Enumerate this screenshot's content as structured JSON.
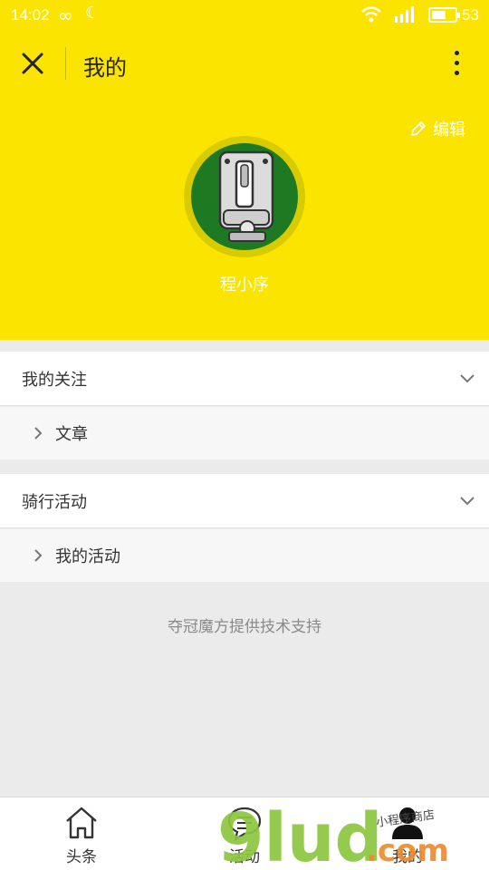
{
  "status_bar": {
    "time": "14:02",
    "battery": "53"
  },
  "nav": {
    "title": "我的"
  },
  "profile": {
    "edit_label": "编辑",
    "username": "程小序"
  },
  "sections": [
    {
      "title": "我的关注",
      "items": [
        "文章"
      ]
    },
    {
      "title": "骑行活动",
      "items": [
        "我的活动"
      ]
    }
  ],
  "footer": {
    "support_text": "夺冠魔方提供技术支持"
  },
  "tabs": [
    {
      "label": "头条",
      "icon": "home-icon"
    },
    {
      "label": "活动",
      "icon": "chat-list-icon"
    },
    {
      "label": "我的",
      "icon": "user-icon"
    }
  ],
  "watermark": {
    "brand": "9lud",
    "suffix": ".com",
    "handwriting": "小程序商店"
  },
  "colors": {
    "header_yellow": "#fbe400",
    "avatar_green": "#1d7a23",
    "watermark_green": "#8cc63f",
    "watermark_orange": "#f08a2a"
  }
}
